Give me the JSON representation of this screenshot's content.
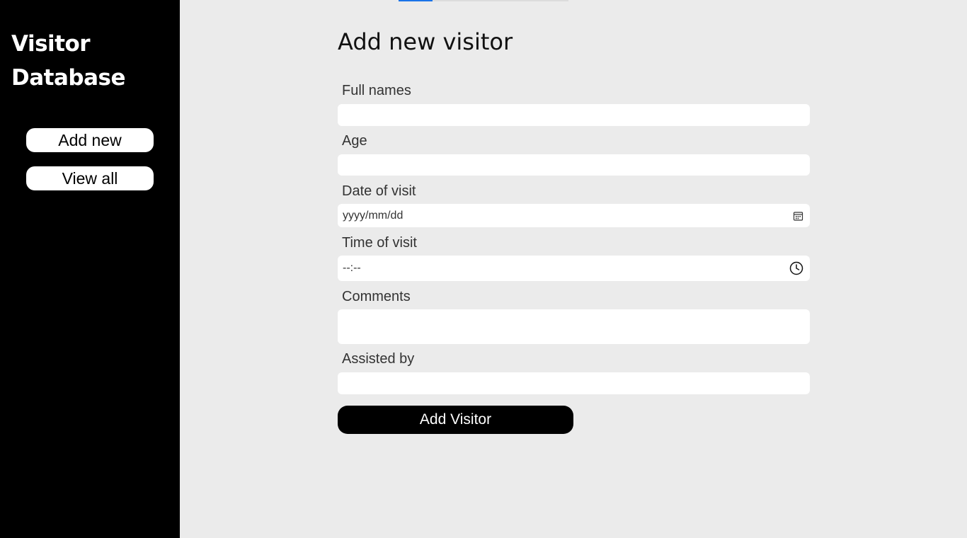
{
  "sidebar": {
    "brand_line1": "Visitor",
    "brand_line2": "Database",
    "nav": {
      "add_new": "Add new",
      "view_all": "View all"
    }
  },
  "form": {
    "title": "Add new visitor",
    "fields": {
      "full_names": {
        "label": "Full names",
        "value": ""
      },
      "age": {
        "label": "Age",
        "value": ""
      },
      "date_of_visit": {
        "label": "Date of visit",
        "placeholder": "yyyy/mm/dd"
      },
      "time_of_visit": {
        "label": "Time of visit",
        "placeholder": "--:--"
      },
      "comments": {
        "label": "Comments",
        "value": ""
      },
      "assisted_by": {
        "label": "Assisted by",
        "value": ""
      }
    },
    "submit_label": "Add Visitor"
  },
  "icons": {
    "date_field": "calendar-icon",
    "time_field": "clock-icon"
  },
  "colors": {
    "sidebar_bg": "#000000",
    "page_bg": "#ebebeb",
    "button_bg": "#000000",
    "button_text": "#ffffff",
    "accent": "#1a73e8"
  }
}
